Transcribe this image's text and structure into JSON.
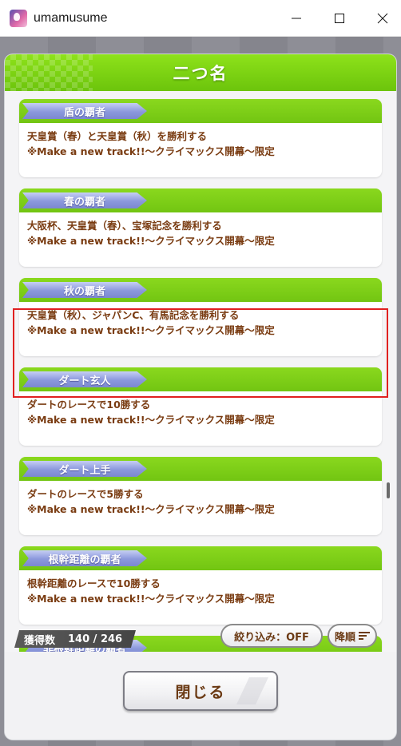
{
  "window": {
    "title": "umamusume",
    "icons": {
      "app": "umamusume-app-icon",
      "minimize": "minimize-icon",
      "maximize": "maximize-icon",
      "close": "close-icon"
    }
  },
  "modal": {
    "title": "二つ名",
    "items": [
      {
        "name": "盾の覇者",
        "line1": "天皇賞（春）と天皇賞（秋）を勝利する",
        "line2": "※Make a new track!!～クライマックス開幕～限定"
      },
      {
        "name": "春の覇者",
        "line1": "大阪杯、天皇賞（春）、宝塚記念を勝利する",
        "line2": "※Make a new track!!～クライマックス開幕～限定"
      },
      {
        "name": "秋の覇者",
        "line1": "天皇賞（秋）、ジャパンC、有馬記念を勝利する",
        "line2": "※Make a new track!!～クライマックス開幕～限定"
      },
      {
        "name": "ダート玄人",
        "line1": "ダートのレースで10勝する",
        "line2": "※Make a new track!!～クライマックス開幕～限定"
      },
      {
        "name": "ダート上手",
        "line1": "ダートのレースで5勝する",
        "line2": "※Make a new track!!～クライマックス開幕～限定"
      },
      {
        "name": "根幹距離の覇者",
        "line1": "根幹距離のレースで10勝する",
        "line2": "※Make a new track!!～クライマックス開幕～限定"
      },
      {
        "name": "非根幹距離の覇者",
        "line1": "",
        "line2": ""
      }
    ],
    "count_label": "獲得数",
    "count_value": "140 / 246",
    "filter_label": "絞り込み：OFF",
    "sort_label": "降順",
    "close_label": "閉じる"
  },
  "colors": {
    "header_green": "#7ed416",
    "tag_purple": "#8b98dc",
    "text_brown": "#7a3c12",
    "highlight_red": "#e02020"
  }
}
